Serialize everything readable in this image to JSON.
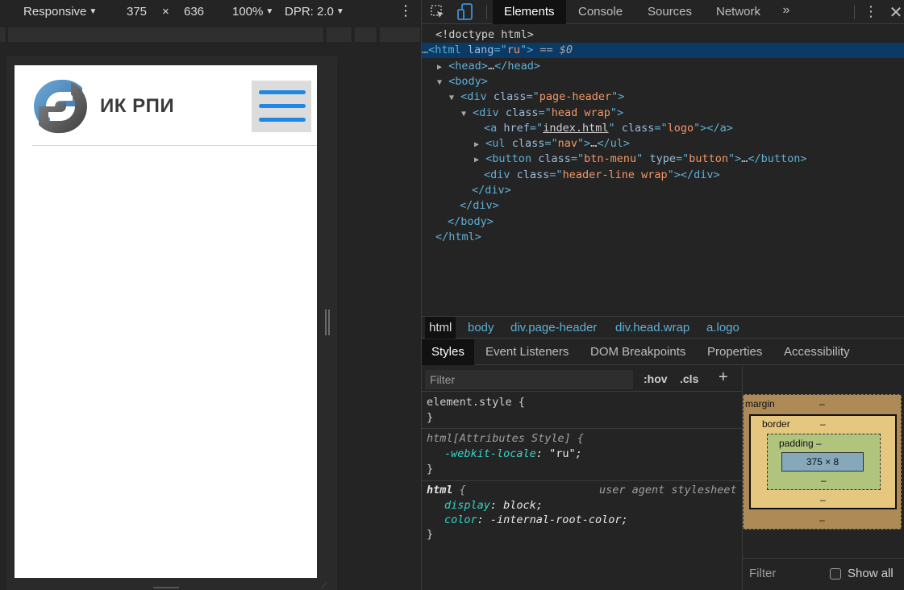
{
  "device_toolbar": {
    "mode": "Responsive",
    "width": "375",
    "times": "×",
    "height": "636",
    "zoom": "100%",
    "dpr": "DPR: 2.0",
    "kebab_icon": "vertical-ellipsis-icon"
  },
  "site": {
    "logo_icon": "ik-rpi-logo",
    "name": "ИК РПИ",
    "menu_icon": "hamburger-icon"
  },
  "devtools": {
    "icons": {
      "inspect": "inspect-element-icon",
      "device": "device-toggle-icon",
      "more": "chevron-double-right-icon",
      "kebab": "vertical-ellipsis-icon",
      "close": "close-icon"
    },
    "tabs": [
      "Elements",
      "Console",
      "Sources",
      "Network"
    ],
    "more_tabs": "»",
    "close": "✕",
    "dom": {
      "doctype": "<!doctype html>",
      "selected_suffix": " == $0",
      "ellipsis": "…"
    },
    "breadcrumbs": [
      "html",
      "body",
      "div.page-header",
      "div.head.wrap",
      "a.logo"
    ],
    "sub_tabs": [
      "Styles",
      "Event Listeners",
      "DOM Breakpoints",
      "Properties",
      "Accessibility"
    ],
    "styles": {
      "filter_placeholder": "Filter",
      "hov": ":hov",
      "cls": ".cls",
      "add": "+",
      "rule1": {
        "selector": "element.style {",
        "close": "}"
      },
      "rule2": {
        "selector": "html[Attributes Style] {",
        "prop": "-webkit-locale",
        "val": "\"ru\"",
        "close": "}"
      },
      "rule3": {
        "selector": "html",
        "brace": " {",
        "source": "user agent stylesheet",
        "props": [
          {
            "name": "display",
            "value": "block"
          },
          {
            "name": "color",
            "value": "-internal-root-color"
          }
        ],
        "close": "}"
      }
    },
    "box_model": {
      "margin_label": "margin",
      "border_label": "border",
      "padding_label": "padding –",
      "content": "375 × 8",
      "dash": "–",
      "filter": "Filter",
      "show_all": "Show all"
    },
    "colors": {
      "selection": "#0b3a66",
      "tag": "#5db0d7",
      "attr_value": "#f29766",
      "css_prop": "#35d4c7",
      "menu_bar": "#1e88e5"
    }
  }
}
